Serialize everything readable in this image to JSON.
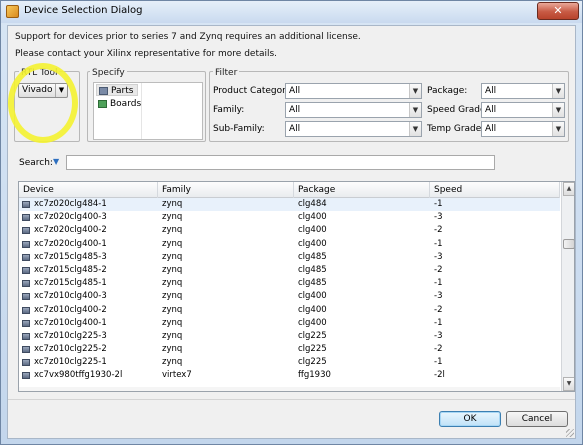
{
  "window": {
    "title": "Device Selection Dialog",
    "close_label": "✕"
  },
  "notice": {
    "line1": "Support for devices prior to series 7 and Zynq requires an additional license.",
    "line2": "Please contact your Xilinx representative for more details."
  },
  "rtl_tool": {
    "label": "RTL Tool",
    "value": "Vivado"
  },
  "specify": {
    "label": "Specify",
    "items": [
      {
        "label": "Parts",
        "icon": "chip-icon",
        "selected": true
      },
      {
        "label": "Boards",
        "icon": "board-icon",
        "selected": false
      }
    ]
  },
  "filter": {
    "label": "Filter",
    "product_category": {
      "label": "Product Category:",
      "value": "All"
    },
    "family": {
      "label": "Family:",
      "value": "All"
    },
    "sub_family": {
      "label": "Sub-Family:",
      "value": "All"
    },
    "package": {
      "label": "Package:",
      "value": "All"
    },
    "speed_grade": {
      "label": "Speed Grade:",
      "value": "All"
    },
    "temp_grade": {
      "label": "Temp Grade:",
      "value": "All"
    }
  },
  "search": {
    "label": "Search:",
    "value": "",
    "placeholder": ""
  },
  "table": {
    "columns": [
      "Device",
      "Family",
      "Package",
      "Speed"
    ],
    "rows": [
      [
        "xc7z020clg484-1",
        "zynq",
        "clg484",
        "-1"
      ],
      [
        "xc7z020clg400-3",
        "zynq",
        "clg400",
        "-3"
      ],
      [
        "xc7z020clg400-2",
        "zynq",
        "clg400",
        "-2"
      ],
      [
        "xc7z020clg400-1",
        "zynq",
        "clg400",
        "-1"
      ],
      [
        "xc7z015clg485-3",
        "zynq",
        "clg485",
        "-3"
      ],
      [
        "xc7z015clg485-2",
        "zynq",
        "clg485",
        "-2"
      ],
      [
        "xc7z015clg485-1",
        "zynq",
        "clg485",
        "-1"
      ],
      [
        "xc7z010clg400-3",
        "zynq",
        "clg400",
        "-3"
      ],
      [
        "xc7z010clg400-2",
        "zynq",
        "clg400",
        "-2"
      ],
      [
        "xc7z010clg400-1",
        "zynq",
        "clg400",
        "-1"
      ],
      [
        "xc7z010clg225-3",
        "zynq",
        "clg225",
        "-3"
      ],
      [
        "xc7z010clg225-2",
        "zynq",
        "clg225",
        "-2"
      ],
      [
        "xc7z010clg225-1",
        "zynq",
        "clg225",
        "-1"
      ],
      [
        "xc7vx980tffg1930-2l",
        "virtex7",
        "ffg1930",
        "-2l"
      ]
    ]
  },
  "buttons": {
    "ok": "OK",
    "cancel": "Cancel"
  },
  "colors": {
    "highlight": "#f4f230",
    "selected_row": "#e8f1fb"
  }
}
